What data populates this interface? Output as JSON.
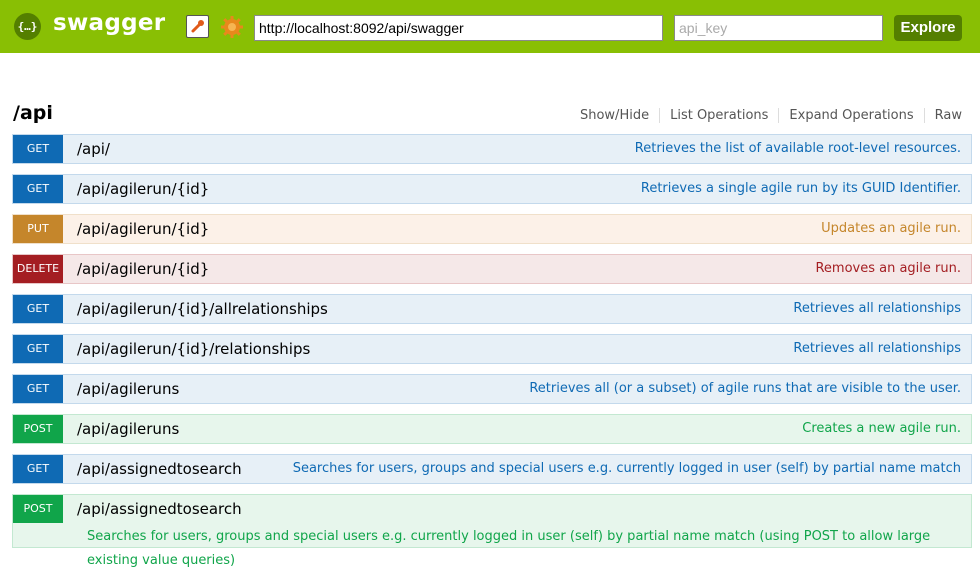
{
  "header": {
    "logo_glyph": "{…}",
    "logo_text": "swagger",
    "url_value": "http://localhost:8092/api/swagger",
    "api_key_placeholder": "api_key",
    "explore_label": "Explore",
    "brand_color": "#89bf04"
  },
  "resource": {
    "title": "/api",
    "operations": [
      "Show/Hide",
      "List Operations",
      "Expand Operations",
      "Raw"
    ]
  },
  "endpoints": [
    {
      "method": "GET",
      "path": "/api/",
      "summary": "Retrieves the list of available root-level resources."
    },
    {
      "method": "GET",
      "path": "/api/agilerun/{id}",
      "summary": "Retrieves a single agile run by its GUID Identifier."
    },
    {
      "method": "PUT",
      "path": "/api/agilerun/{id}",
      "summary": "Updates an agile run."
    },
    {
      "method": "DELETE",
      "path": "/api/agilerun/{id}",
      "summary": "Removes an agile run."
    },
    {
      "method": "GET",
      "path": "/api/agilerun/{id}/allrelationships",
      "summary": "Retrieves all relationships"
    },
    {
      "method": "GET",
      "path": "/api/agilerun/{id}/relationships",
      "summary": "Retrieves all relationships"
    },
    {
      "method": "GET",
      "path": "/api/agileruns",
      "summary": "Retrieves all (or a subset) of agile runs that are visible to the user."
    },
    {
      "method": "POST",
      "path": "/api/agileruns",
      "summary": "Creates a new agile run."
    },
    {
      "method": "GET",
      "path": "/api/assignedtosearch",
      "summary": "Searches for users, groups and special users e.g. currently logged in user (self) by partial name match"
    },
    {
      "method": "POST",
      "path": "/api/assignedtosearch",
      "summary": "Searches for users, groups and special users e.g. currently logged in user (self) by partial name match (using POST to allow large existing value queries)"
    }
  ],
  "method_colors": {
    "GET": "#0f6ab4",
    "PUT": "#c5862b",
    "DELETE": "#a41e22",
    "POST": "#10a54a"
  }
}
